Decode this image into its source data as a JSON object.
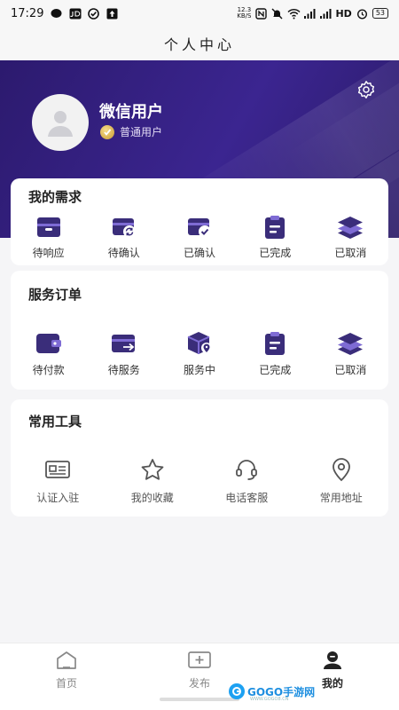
{
  "status_bar": {
    "time": "17:29",
    "net_speed_value": "12.3",
    "net_speed_unit": "KB/S",
    "network_label": "HD",
    "battery": "53"
  },
  "title": "个人中心",
  "profile": {
    "name": "微信用户",
    "level": "普通用户"
  },
  "needs": {
    "title": "我的需求",
    "items": [
      {
        "label": "待响应",
        "icon": "tray-icon"
      },
      {
        "label": "待确认",
        "icon": "refresh-card-icon"
      },
      {
        "label": "已确认",
        "icon": "check-card-icon"
      },
      {
        "label": "已完成",
        "icon": "clipboard-icon"
      },
      {
        "label": "已取消",
        "icon": "layers-icon"
      }
    ]
  },
  "orders": {
    "title": "服务订单",
    "items": [
      {
        "label": "待付款",
        "icon": "wallet-icon"
      },
      {
        "label": "待服务",
        "icon": "card-arrow-icon"
      },
      {
        "label": "服务中",
        "icon": "box-location-icon"
      },
      {
        "label": "已完成",
        "icon": "clipboard-icon"
      },
      {
        "label": "已取消",
        "icon": "layers-icon"
      }
    ]
  },
  "tools": {
    "title": "常用工具",
    "items": [
      {
        "label": "认证入驻",
        "icon": "id-card-icon"
      },
      {
        "label": "我的收藏",
        "icon": "star-icon"
      },
      {
        "label": "电话客服",
        "icon": "headset-icon"
      },
      {
        "label": "常用地址",
        "icon": "location-icon"
      }
    ]
  },
  "nav": {
    "items": [
      {
        "label": "首页",
        "icon": "home-icon",
        "active": false
      },
      {
        "label": "发布",
        "icon": "publish-icon",
        "active": false
      },
      {
        "label": "我的",
        "icon": "profile-icon",
        "active": true
      }
    ]
  },
  "watermark": {
    "text": "GOGO手游网",
    "sub": "WWW.GOGO8.CN"
  },
  "colors": {
    "brand": "#3b2590",
    "icon_dark": "#3a2d7a",
    "icon_accent": "#7e6bd4"
  }
}
